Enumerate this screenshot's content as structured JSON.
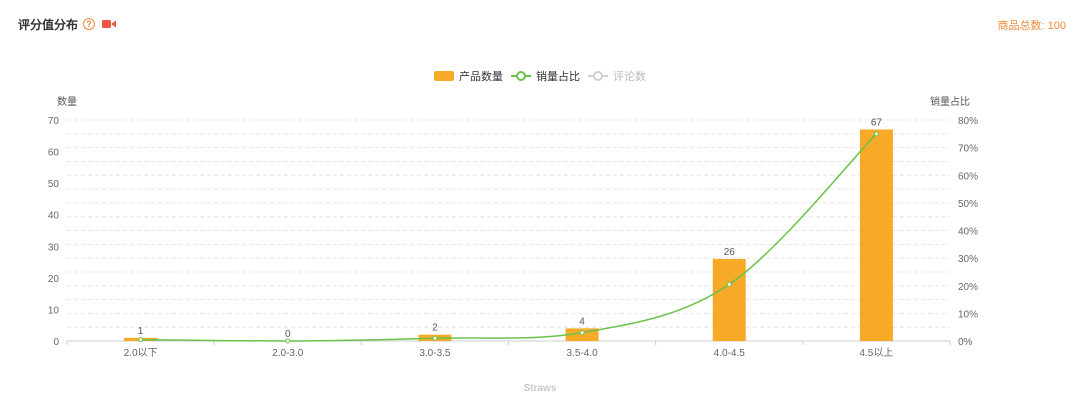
{
  "header": {
    "title": "评分值分布",
    "help_icon": "question-circle-icon",
    "video_icon": "video-camera-icon",
    "accent_color": "#f08c3c"
  },
  "total": {
    "label": "商品总数: 100"
  },
  "legend": {
    "items": [
      {
        "label": "产品数量",
        "active": true
      },
      {
        "label": "销量占比",
        "active": true
      },
      {
        "label": "评论数",
        "active": false
      }
    ]
  },
  "watermark": "Straws",
  "chart_data": {
    "type": "bar",
    "categories": [
      "2.0以下",
      "2.0-3.0",
      "3.0-3.5",
      "3.5-4.0",
      "4.0-4.5",
      "4.5以上"
    ],
    "series": [
      {
        "name": "产品数量",
        "type": "bar",
        "axis": "left",
        "values": [
          1,
          0,
          2,
          4,
          26,
          67
        ],
        "color": "#f7a928",
        "data_labels": true
      },
      {
        "name": "销量占比",
        "type": "line",
        "axis": "right",
        "values": [
          0.5,
          0,
          1,
          3,
          20.5,
          75
        ],
        "color": "#6cc24a",
        "smooth": true
      },
      {
        "name": "评论数",
        "type": "line",
        "axis": "right",
        "values": [],
        "color": "#d0d0d0",
        "hidden": true
      }
    ],
    "y_left": {
      "label": "数量",
      "ylim": [
        0,
        70
      ],
      "ticks": [
        "0",
        "10",
        "20",
        "30",
        "40",
        "50",
        "60",
        "70"
      ]
    },
    "y_right": {
      "label": "销量占比",
      "ylim": [
        0,
        80
      ],
      "ticks": [
        "0%",
        "10%",
        "20%",
        "30%",
        "40%",
        "50%",
        "60%",
        "70%",
        "80%"
      ]
    },
    "grid": true,
    "legend_position": "top-center"
  }
}
